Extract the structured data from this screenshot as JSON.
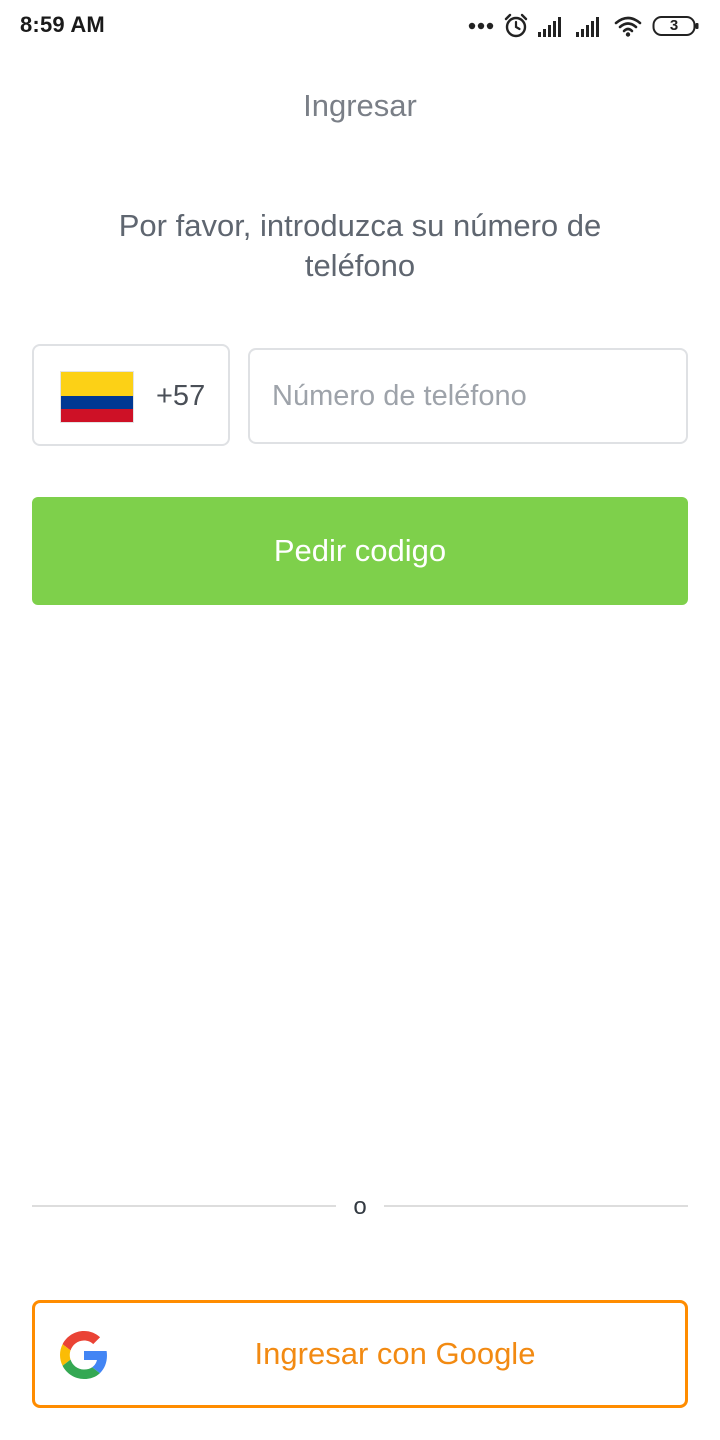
{
  "status_bar": {
    "time": "8:59 AM",
    "battery_level": "3",
    "icons": [
      "more-dots-icon",
      "alarm-icon",
      "signal-icon",
      "signal-icon",
      "wifi-icon",
      "battery-icon"
    ]
  },
  "header": {
    "title": "Ingresar"
  },
  "prompt": {
    "text": "Por favor, introduzca su número de teléfono"
  },
  "phone": {
    "country_flag": "colombia-flag",
    "dial_code": "+57",
    "placeholder": "Número de teléfono",
    "value": ""
  },
  "actions": {
    "request_code_label": "Pedir codigo",
    "divider_label": "o",
    "google_label": "Ingresar con Google"
  },
  "colors": {
    "primary_green": "#7ed04b",
    "google_orange": "#ff8c00",
    "title_gray": "#7a7f87"
  }
}
